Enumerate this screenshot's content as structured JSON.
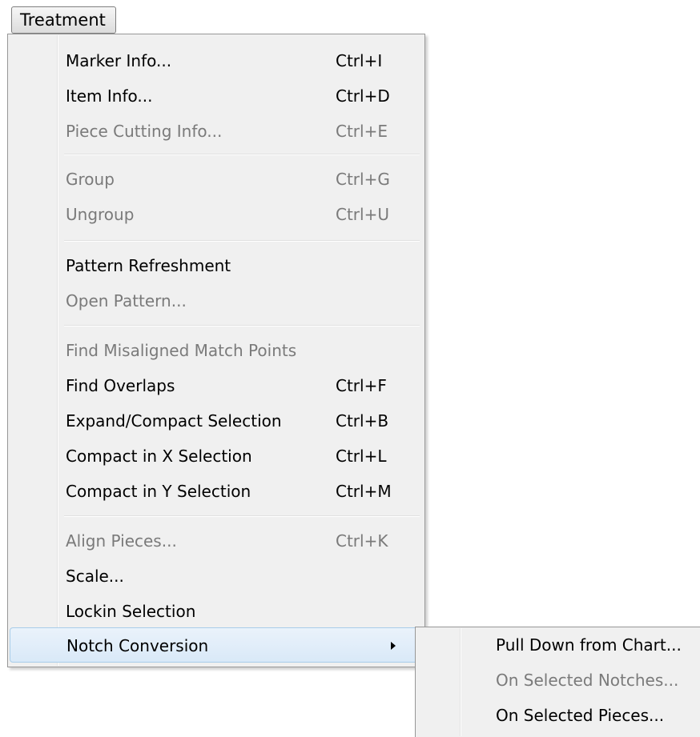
{
  "menubar": {
    "active_menu": "Treatment"
  },
  "menu": {
    "items": [
      {
        "label": "Marker Info...",
        "shortcut": "Ctrl+I",
        "enabled": true
      },
      {
        "label": "Item Info...",
        "shortcut": "Ctrl+D",
        "enabled": true
      },
      {
        "label": "Piece Cutting Info...",
        "shortcut": "Ctrl+E",
        "enabled": false
      },
      {
        "label": "Group",
        "shortcut": "Ctrl+G",
        "enabled": false
      },
      {
        "label": "Ungroup",
        "shortcut": "Ctrl+U",
        "enabled": false
      },
      {
        "label": "Pattern Refreshment",
        "shortcut": "",
        "enabled": true
      },
      {
        "label": "Open Pattern...",
        "shortcut": "",
        "enabled": false
      },
      {
        "label": "Find Misaligned Match Points",
        "shortcut": "",
        "enabled": false
      },
      {
        "label": "Find Overlaps",
        "shortcut": "Ctrl+F",
        "enabled": true
      },
      {
        "label": "Expand/Compact Selection",
        "shortcut": "Ctrl+B",
        "enabled": true
      },
      {
        "label": "Compact in X Selection",
        "shortcut": "Ctrl+L",
        "enabled": true
      },
      {
        "label": "Compact in Y Selection",
        "shortcut": "Ctrl+M",
        "enabled": true
      },
      {
        "label": "Align Pieces...",
        "shortcut": "Ctrl+K",
        "enabled": false
      },
      {
        "label": "Scale...",
        "shortcut": "",
        "enabled": true
      },
      {
        "label": "Lockin Selection",
        "shortcut": "",
        "enabled": true
      },
      {
        "label": "Notch Conversion",
        "shortcut": "",
        "enabled": true,
        "has_submenu": true,
        "highlighted": true
      }
    ]
  },
  "submenu": {
    "parent": "Notch Conversion",
    "items": [
      {
        "label": "Pull Down from Chart...",
        "enabled": true
      },
      {
        "label": "On Selected Notches...",
        "enabled": false
      },
      {
        "label": "On Selected Pieces...",
        "enabled": true
      }
    ]
  },
  "icons": {
    "submenu_arrow": "submenu-arrow-icon"
  }
}
